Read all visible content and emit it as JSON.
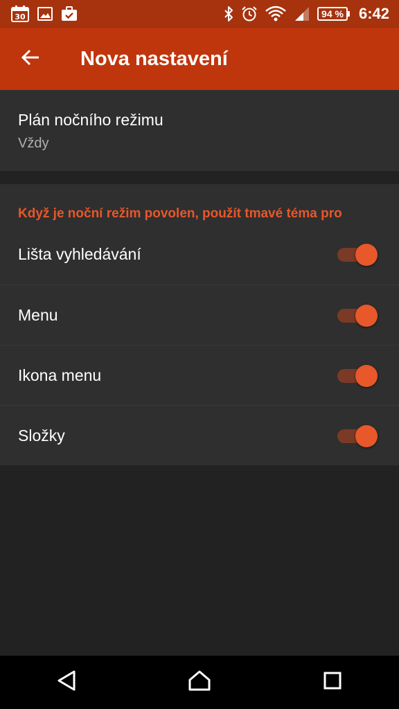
{
  "status_bar": {
    "calendar_day": "30",
    "battery": "94 %",
    "time": "6:42"
  },
  "app_bar": {
    "title": "Nova nastavení"
  },
  "night_mode_schedule": {
    "title": "Plán nočního režimu",
    "value": "Vždy"
  },
  "dark_theme_section": {
    "header": "Když je noční režim povolen, použít tmavé téma pro",
    "items": [
      {
        "label": "Lišta vyhledávání",
        "enabled": true
      },
      {
        "label": "Menu",
        "enabled": true
      },
      {
        "label": "Ikona menu",
        "enabled": true
      },
      {
        "label": "Složky",
        "enabled": true
      }
    ]
  },
  "colors": {
    "app_bar": "#bf360c",
    "status_bar": "#a6330e",
    "accent": "#e8582a",
    "background": "#222222",
    "card": "#2f2f2f"
  }
}
